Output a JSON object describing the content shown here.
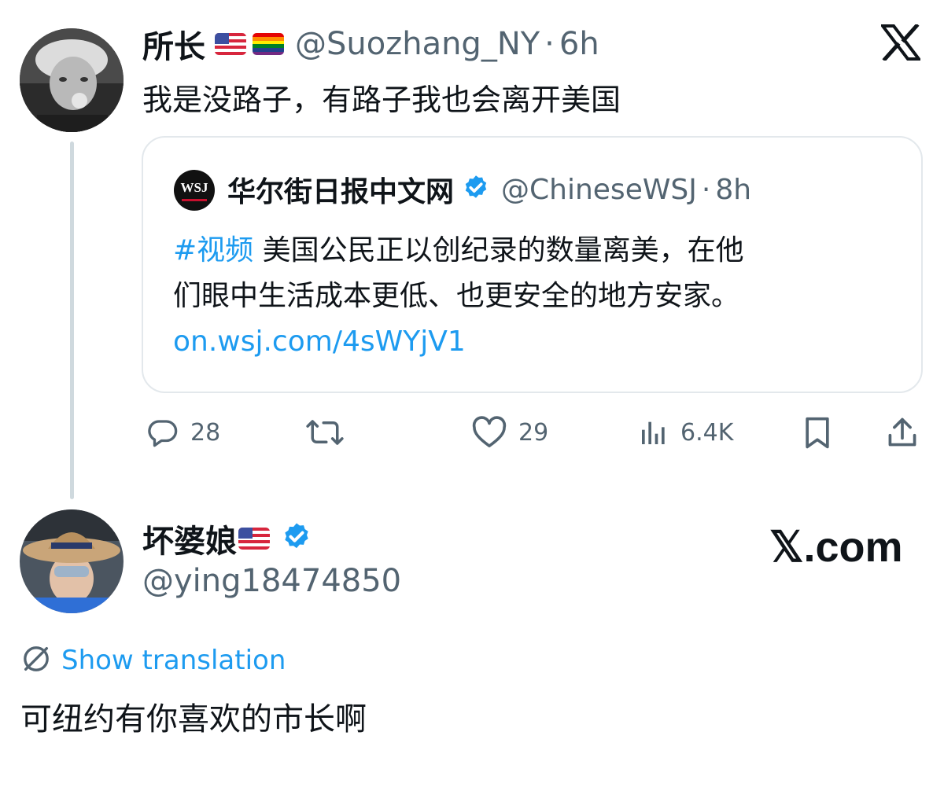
{
  "original_tweet": {
    "author_name": "所长",
    "flags": [
      "us-flag-icon",
      "rainbow-flag-icon"
    ],
    "handle": "@Suozhang_NY",
    "separator": "·",
    "time": "6h",
    "text": "我是没路子，有路子我也会离开美国"
  },
  "quoted_tweet": {
    "logo_text": "WSJ",
    "author_name": "华尔街日报中文网",
    "verified": true,
    "handle": "@ChineseWSJ",
    "separator": "·",
    "time": "8h",
    "hashtag": "#视频",
    "text_line1": "美国公民正以创纪录的数量离美，在他",
    "text_line2": "们眼中生活成本更低、也更安全的地方安家。",
    "link": "on.wsj.com/4sWYjV1"
  },
  "actions": {
    "replies": "28",
    "likes": "29",
    "views": "6.4K"
  },
  "reply_tweet": {
    "author_name": "坏婆娘",
    "verified": true,
    "handle": "@ying18474850",
    "show_translation": "Show translation",
    "text": "可纽约有你喜欢的市长啊"
  },
  "watermark": "𝕏.com",
  "colors": {
    "link": "#1d9bf0",
    "muted": "#536471",
    "verified": "#1d9bf0",
    "border": "#e3e8ec"
  }
}
